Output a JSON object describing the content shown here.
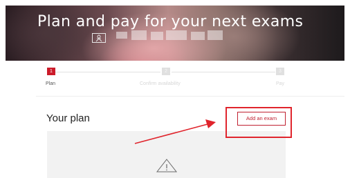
{
  "hero": {
    "title": "Plan and pay for your next exams",
    "icon": "id-card-icon",
    "blurred_account_text": "obscured"
  },
  "stepper": {
    "steps": [
      {
        "number": "1",
        "label": "Plan",
        "active": true
      },
      {
        "number": "2",
        "label": "Confirm availability",
        "active": false
      },
      {
        "number": "3",
        "label": "Pay",
        "active": false
      }
    ],
    "active_color": "#cc1b2a"
  },
  "plan": {
    "title": "Your plan",
    "add_exam_label": "Add an exam",
    "empty_state_icon": "warning-triangle-icon"
  },
  "annotation": {
    "color": "#e0242c",
    "type": "arrow-and-highlight-box"
  }
}
